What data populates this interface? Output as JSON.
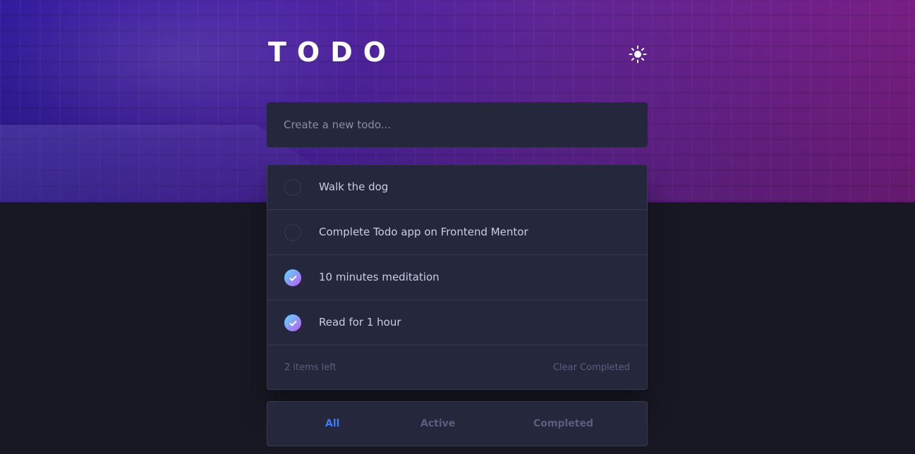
{
  "header": {
    "title": "TODO",
    "theme_icon": "sun-icon"
  },
  "new_todo": {
    "placeholder": "Create a new todo..."
  },
  "todos": [
    {
      "text": "Walk the dog",
      "completed": false
    },
    {
      "text": "Complete Todo app on Frontend Mentor",
      "completed": false
    },
    {
      "text": "10 minutes meditation",
      "completed": true
    },
    {
      "text": "Read for 1 hour",
      "completed": true
    }
  ],
  "footer": {
    "items_left": "2 items left",
    "clear_label": "Clear Completed"
  },
  "filters": {
    "all": "All",
    "active": "Active",
    "completed": "Completed",
    "selected": "All"
  },
  "colors": {
    "accent": "#3a7cfd",
    "check_gradient_start": "#57ddff",
    "check_gradient_end": "#c058f3",
    "card": "#25273c",
    "background": "#181824"
  }
}
